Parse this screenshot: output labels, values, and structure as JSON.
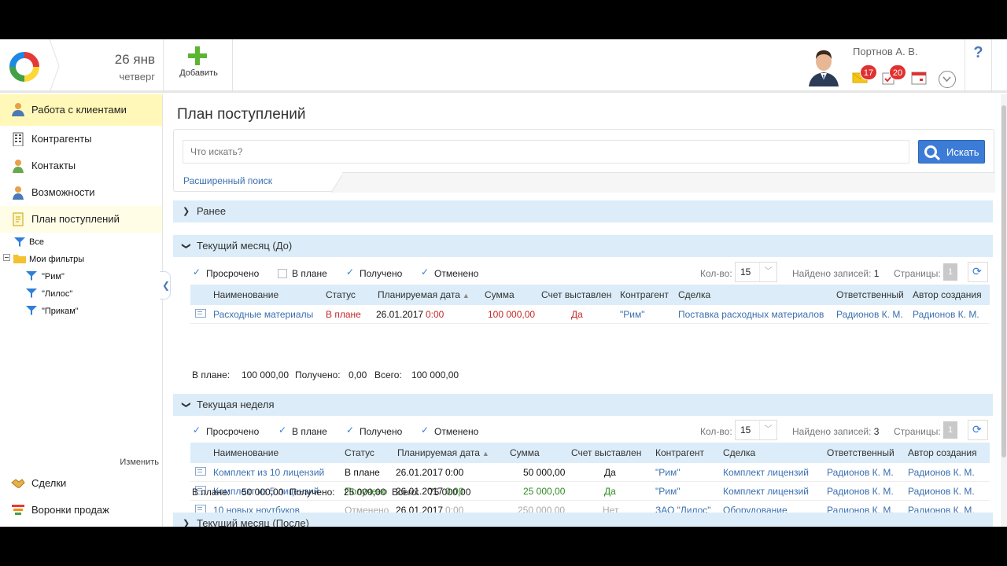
{
  "header": {
    "date_day": "26 янв",
    "weekday": "четверг",
    "add_label": "Добавить",
    "user_name": "Портнов А. В.",
    "mail_count": "17",
    "tasks_count": "20",
    "help": "?"
  },
  "sidebar": {
    "section_title": "Работа с клиентами",
    "items": [
      {
        "label": "Контрагенты"
      },
      {
        "label": "Контакты"
      },
      {
        "label": "Возможности"
      },
      {
        "label": "План поступлений"
      }
    ],
    "tree": {
      "all": "Все",
      "my_filters": "Мои фильтры",
      "filters": [
        "\"Рим\"",
        "\"Лилос\"",
        "\"Прикам\""
      ]
    },
    "edit_label": "Изменить",
    "bottom_items": [
      {
        "label": "Сделки"
      },
      {
        "label": "Воронки продаж"
      }
    ]
  },
  "main": {
    "title": "План поступлений",
    "search": {
      "placeholder": "Что искать?",
      "button": "Искать",
      "advanced": "Расширенный поиск"
    },
    "filter_labels": {
      "overdue": "Просрочено",
      "planned": "В плане",
      "received": "Получено",
      "cancelled": "Отменено",
      "qty": "Кол-во:",
      "found": "Найдено записей:",
      "pages": "Страницы:"
    },
    "columns": {
      "name": "Наименование",
      "status": "Статус",
      "date": "Планируемая дата",
      "sum": "Сумма",
      "invoice": "Счет выставлен",
      "counterparty": "Контрагент",
      "deal": "Сделка",
      "responsible": "Ответственный",
      "author": "Автор создания"
    },
    "sections": {
      "earlier": {
        "title": "Ранее"
      },
      "current_month_before": {
        "title": "Текущий месяц (До)",
        "qty": "15",
        "found": "1",
        "page": "1",
        "rows": [
          {
            "name": "Расходные материалы",
            "status": "В плане",
            "date": "26.01.2017",
            "time": "0:00",
            "sum": "100 000,00",
            "invoice": "Да",
            "counterparty": "\"Рим\"",
            "deal": "Поставка расходных материалов",
            "responsible": "Радионов К. М.",
            "author": "Радионов К. М."
          }
        ],
        "totals": {
          "planned_label": "В плане:",
          "planned": "100 000,00",
          "received_label": "Получено:",
          "received": "0,00",
          "total_label": "Всего:",
          "total": "100 000,00"
        }
      },
      "current_week": {
        "title": "Текущая неделя",
        "qty": "15",
        "found": "3",
        "page": "1",
        "rows": [
          {
            "name": "Комплект из 10 лицензий",
            "status": "В плане",
            "date": "26.01.2017",
            "time": "0:00",
            "sum": "50 000,00",
            "invoice": "Да",
            "counterparty": "\"Рим\"",
            "deal": "Комплект лицензий",
            "responsible": "Радионов К. М.",
            "author": "Радионов К. М."
          },
          {
            "name": "Комплект из 5 лицензий",
            "status": "Получено",
            "date": "26.01.2017",
            "time": "0:00",
            "sum": "25 000,00",
            "invoice": "Да",
            "counterparty": "\"Рим\"",
            "deal": "Комплект лицензий",
            "responsible": "Радионов К. М.",
            "author": "Радионов К. М."
          },
          {
            "name": "10 новых ноутбуков",
            "status": "Отменено",
            "date": "26.01.2017",
            "time": "0:00",
            "sum": "250 000,00",
            "invoice": "Нет",
            "counterparty": "ЗАО \"Лилос\"",
            "deal": "Оборудование",
            "responsible": "Радионов К. М.",
            "author": "Радионов К. М."
          }
        ],
        "totals": {
          "planned_label": "В плане:",
          "planned": "50 000,00",
          "received_label": "Получено:",
          "received": "25 000,00",
          "total_label": "Всего:",
          "total": "75 000,00"
        }
      },
      "current_month_after": {
        "title": "Текущий месяц (После)"
      }
    }
  },
  "colors": {
    "accent": "#3c7cd6",
    "section_bg": "#dcedf9",
    "active_nav": "#fff8b8",
    "planned_red": "#c62828",
    "received_green": "#2e8b22",
    "cancelled_gray": "#aaaaaa"
  }
}
